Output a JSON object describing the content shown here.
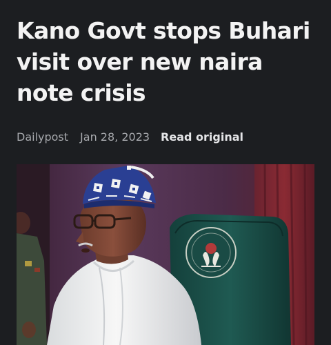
{
  "article": {
    "headline": "Kano Govt stops Buhari visit over new naira note crisis",
    "source": "Dailypost",
    "date": "Jan 28, 2023",
    "read_original_label": "Read original"
  },
  "photo": {
    "subject": "man-in-white-robe-and-blue-cap",
    "colors": {
      "background": "#4a2a45",
      "curtain": "#6d2330",
      "chair": "#1f5850",
      "robe": "#f3f3f3",
      "cap": "#2a3f93"
    }
  },
  "icons": {
    "seal": "seal-icon"
  }
}
